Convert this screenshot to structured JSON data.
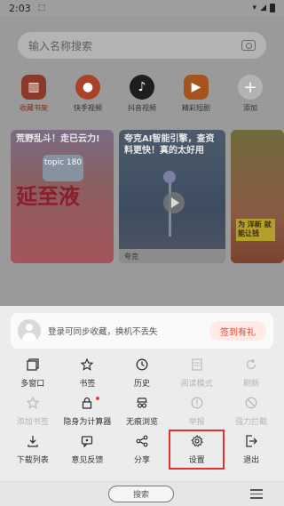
{
  "status_bar": {
    "time": "2:03"
  },
  "search": {
    "placeholder": "输入名称搜索"
  },
  "shortcuts": [
    {
      "label": "收藏书架",
      "icon": "bookshelf-icon",
      "color": "#8b3a2a"
    },
    {
      "label": "快手视频",
      "icon": "kuaishou-icon",
      "color": "#a8432a"
    },
    {
      "label": "抖音视频",
      "icon": "douyin-icon",
      "color": "#1e1e1e"
    },
    {
      "label": "精彩短剧",
      "icon": "short-drama-icon",
      "color": "#a6541f"
    },
    {
      "label": "添加",
      "icon": "add-icon",
      "color": "#b3b3b3"
    }
  ],
  "cards": [
    {
      "title": "荒野乱斗！走已云力!",
      "overlay": "topic 180",
      "big": "延至液"
    },
    {
      "title": "夸克AI智能引擎，查资料更快！真的太好用",
      "footer": "夸克"
    },
    {
      "title": "",
      "promo": "为 洋新 就能让钱"
    }
  ],
  "sheet": {
    "login_text": "登录可同步收藏，换机不丢失",
    "checkin_label": "签到有礼",
    "accent": "#e4442e",
    "items": [
      {
        "label": "多窗口",
        "icon": "multi-window-icon",
        "enabled": true
      },
      {
        "label": "书签",
        "icon": "star-icon",
        "enabled": true
      },
      {
        "label": "历史",
        "icon": "clock-icon",
        "enabled": true
      },
      {
        "label": "阅读模式",
        "icon": "reader-mode-icon",
        "enabled": false
      },
      {
        "label": "刷新",
        "icon": "refresh-icon",
        "enabled": false
      },
      {
        "label": "添加书签",
        "icon": "add-bookmark-icon",
        "enabled": false
      },
      {
        "label": "隐身为计算器",
        "icon": "lock-icon",
        "enabled": true,
        "badge": true
      },
      {
        "label": "无痕浏览",
        "icon": "incognito-icon",
        "enabled": true
      },
      {
        "label": "举报",
        "icon": "report-icon",
        "enabled": false
      },
      {
        "label": "强力拦截",
        "icon": "block-icon",
        "enabled": false
      },
      {
        "label": "下载列表",
        "icon": "download-icon",
        "enabled": true
      },
      {
        "label": "意见反馈",
        "icon": "feedback-icon",
        "enabled": true
      },
      {
        "label": "分享",
        "icon": "share-icon",
        "enabled": true
      },
      {
        "label": "设置",
        "icon": "gear-icon",
        "enabled": true,
        "highlighted": true
      },
      {
        "label": "退出",
        "icon": "exit-icon",
        "enabled": true
      }
    ]
  },
  "bottom_bar": {
    "search_label": "搜索"
  }
}
